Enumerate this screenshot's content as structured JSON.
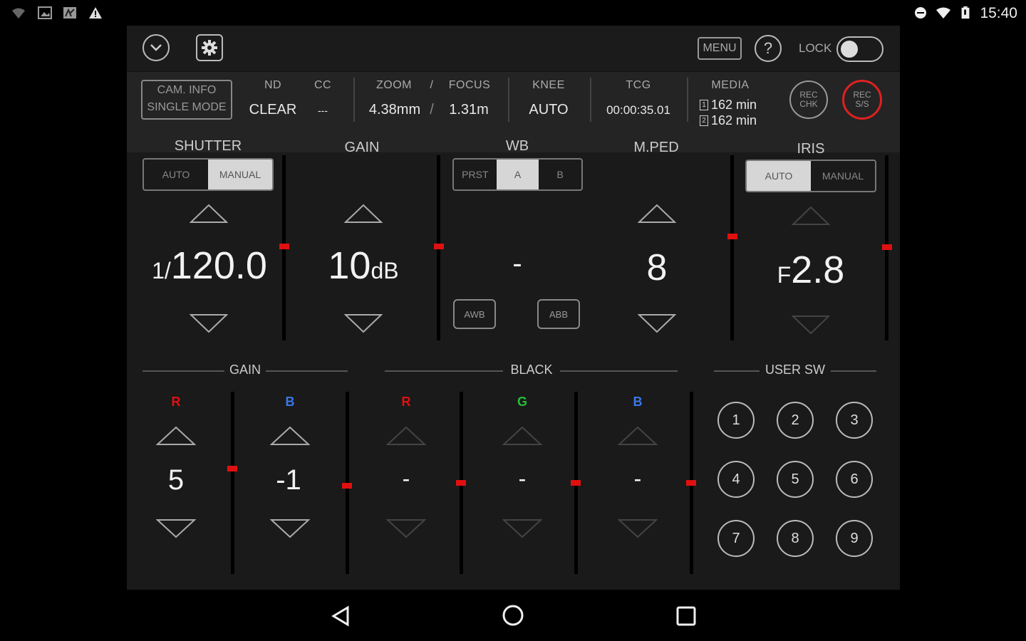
{
  "status_bar": {
    "time": "15:40",
    "left_icons": [
      "wifi-question-icon",
      "image-icon",
      "photo-icon",
      "warning-icon"
    ],
    "right_icons": [
      "dnd-icon",
      "wifi-icon",
      "battery-icon"
    ]
  },
  "toolbar": {
    "menu_label": "MENU",
    "help_label": "?",
    "lock_label": "LOCK",
    "lock_on": false
  },
  "info": {
    "cam_info_line1": "CAM. INFO",
    "cam_info_line2": "SINGLE MODE",
    "nd_label": "ND",
    "nd_value": "CLEAR",
    "cc_label": "CC",
    "cc_value": "---",
    "zoom_label": "ZOOM",
    "slash": "/",
    "focus_label": "FOCUS",
    "zoom_value": "4.38mm",
    "focus_value": "1.31m",
    "knee_label": "KNEE",
    "knee_value": "AUTO",
    "tcg_label": "TCG",
    "tcg_value": "00:00:35.01",
    "media_label": "MEDIA",
    "media1_slot": "1",
    "media1_value": "162 min",
    "media2_slot": "2",
    "media2_value": "162 min",
    "rec_chk_line1": "REC",
    "rec_chk_line2": "CHK",
    "rec_ss_line1": "REC",
    "rec_ss_line2": "S/S"
  },
  "shutter": {
    "title": "SHUTTER",
    "auto": "AUTO",
    "manual": "MANUAL",
    "prefix": "1/",
    "value": "120.0"
  },
  "gain": {
    "title": "GAIN",
    "value": "10",
    "unit": "dB"
  },
  "wb": {
    "title": "WB",
    "prst": "PRST",
    "a": "A",
    "b": "B",
    "value": "-",
    "awb": "AWB",
    "abb": "ABB"
  },
  "mped": {
    "title": "M.PED",
    "value": "8"
  },
  "iris": {
    "title": "IRIS",
    "auto": "AUTO",
    "manual": "MANUAL",
    "prefix": "F",
    "value": "2.8"
  },
  "lower": {
    "gain_title": "GAIN",
    "black_title": "BLACK",
    "usersw_title": "USER SW",
    "gain_r_label": "R",
    "gain_r_value": "5",
    "gain_b_label": "B",
    "gain_b_value": "-1",
    "black_r_label": "R",
    "black_r_value": "-",
    "black_g_label": "G",
    "black_g_value": "-",
    "black_b_label": "B",
    "black_b_value": "-",
    "user_buttons": [
      "1",
      "2",
      "3",
      "4",
      "5",
      "6",
      "7",
      "8",
      "9"
    ]
  },
  "colors": {
    "red": "#e01010",
    "green": "#22c03a",
    "blue": "#3a78e8",
    "rec_ring": "#e02020"
  }
}
